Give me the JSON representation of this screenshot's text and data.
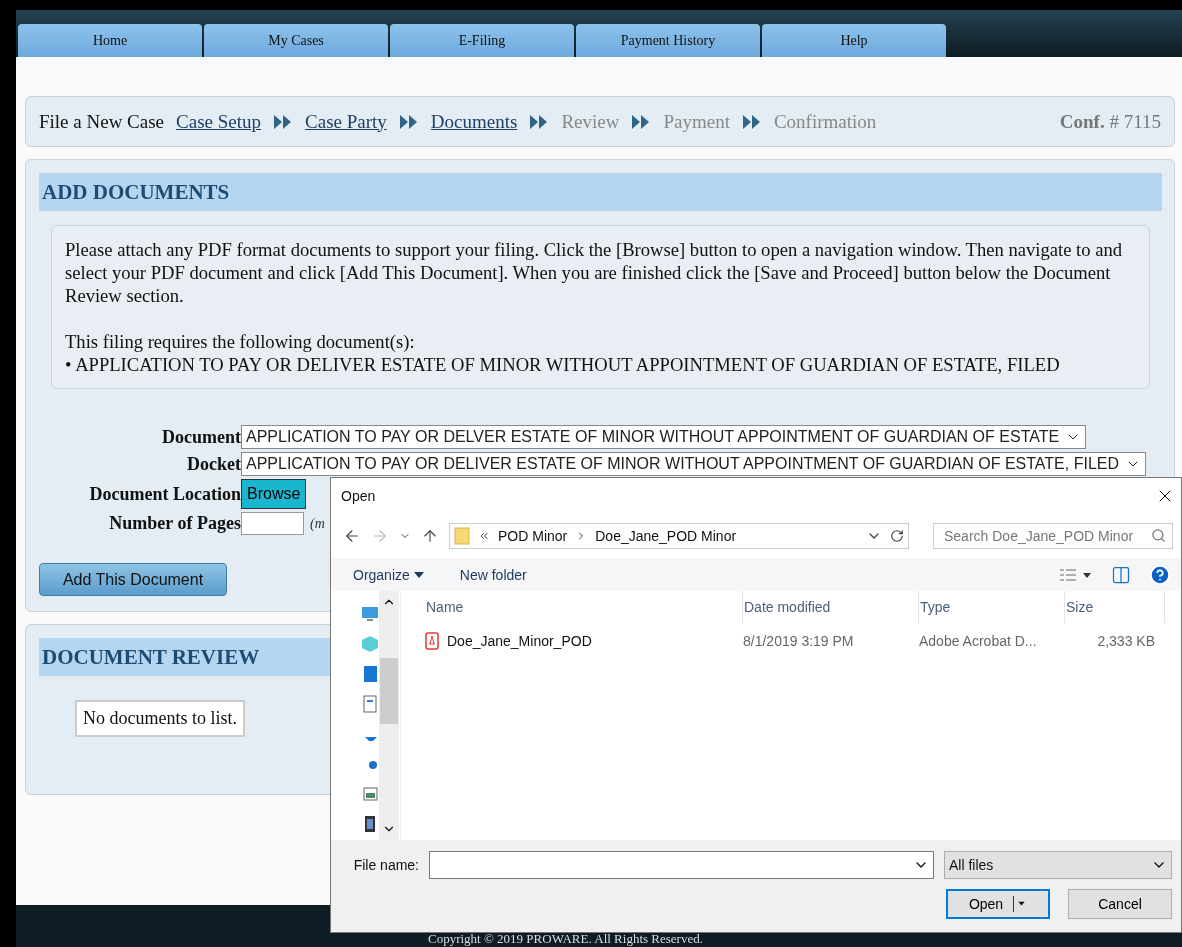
{
  "nav_tabs": [
    {
      "label": "Home"
    },
    {
      "label": "My Cases"
    },
    {
      "label": "E-Filing"
    },
    {
      "label": "Payment History"
    },
    {
      "label": "Help"
    }
  ],
  "breadcrumb": {
    "title": "File a New Case",
    "steps": [
      {
        "label": "Case Setup",
        "enabled": true
      },
      {
        "label": "Case Party",
        "enabled": true
      },
      {
        "label": "Documents",
        "enabled": true
      },
      {
        "label": "Review",
        "enabled": false
      },
      {
        "label": "Payment",
        "enabled": false
      },
      {
        "label": "Confirmation",
        "enabled": false
      }
    ],
    "conf_label": "Conf.",
    "conf_number": "# 7115"
  },
  "add_documents": {
    "heading": "ADD DOCUMENTS",
    "instructions": "Please attach any PDF format documents to support your filing. Click the [Browse] button to open a navigation window. Then navigate to and select your PDF document and click [Add This Document]. When you are finished click the [Save and Proceed] button below the Document Review section.",
    "requirement_intro": "This filing requires the following document(s):",
    "required_documents": [
      "• APPLICATION TO PAY OR DELIVER ESTATE OF MINOR WITHOUT APPOINTMENT OF GUARDIAN OF ESTATE, FILED"
    ],
    "document": {
      "label": "Document",
      "value": "APPLICATION TO PAY OR DELVER ESTATE OF MINOR WITHOUT APPOINTMENT OF GUARDIAN OF ESTATE"
    },
    "docket": {
      "label": "Docket",
      "value": "APPLICATION TO PAY OR DELIVER ESTATE OF MINOR WITHOUT APPOINTMENT OF GUARDIAN OF ESTATE, FILED"
    },
    "location": {
      "label": "Document Location",
      "button": "Browse"
    },
    "pages": {
      "label": "Number of Pages",
      "note": "(m"
    },
    "add_button": "Add This Document"
  },
  "document_review": {
    "heading": "DOCUMENT REVIEW",
    "empty_text": "No documents to list."
  },
  "footer": {
    "copyright": "Copyright © 2019 PROWARE. All Rights Reserved."
  },
  "open_dialog": {
    "title": "Open",
    "path": [
      "POD Minor",
      "Doe_Jane_POD Minor"
    ],
    "search_placeholder": "Search Doe_Jane_POD Minor",
    "toolbar": [
      "Organize",
      "New folder"
    ],
    "columns": [
      "Name",
      "Date modified",
      "Type",
      "Size"
    ],
    "files": [
      {
        "name": "Doe_Jane_Minor_POD",
        "date": "8/1/2019 3:19 PM",
        "type": "Adobe Acrobat D...",
        "size": "2,333 KB"
      }
    ],
    "file_name_label": "File name:",
    "filter": "All files",
    "buttons": [
      "Open",
      "Cancel"
    ]
  }
}
